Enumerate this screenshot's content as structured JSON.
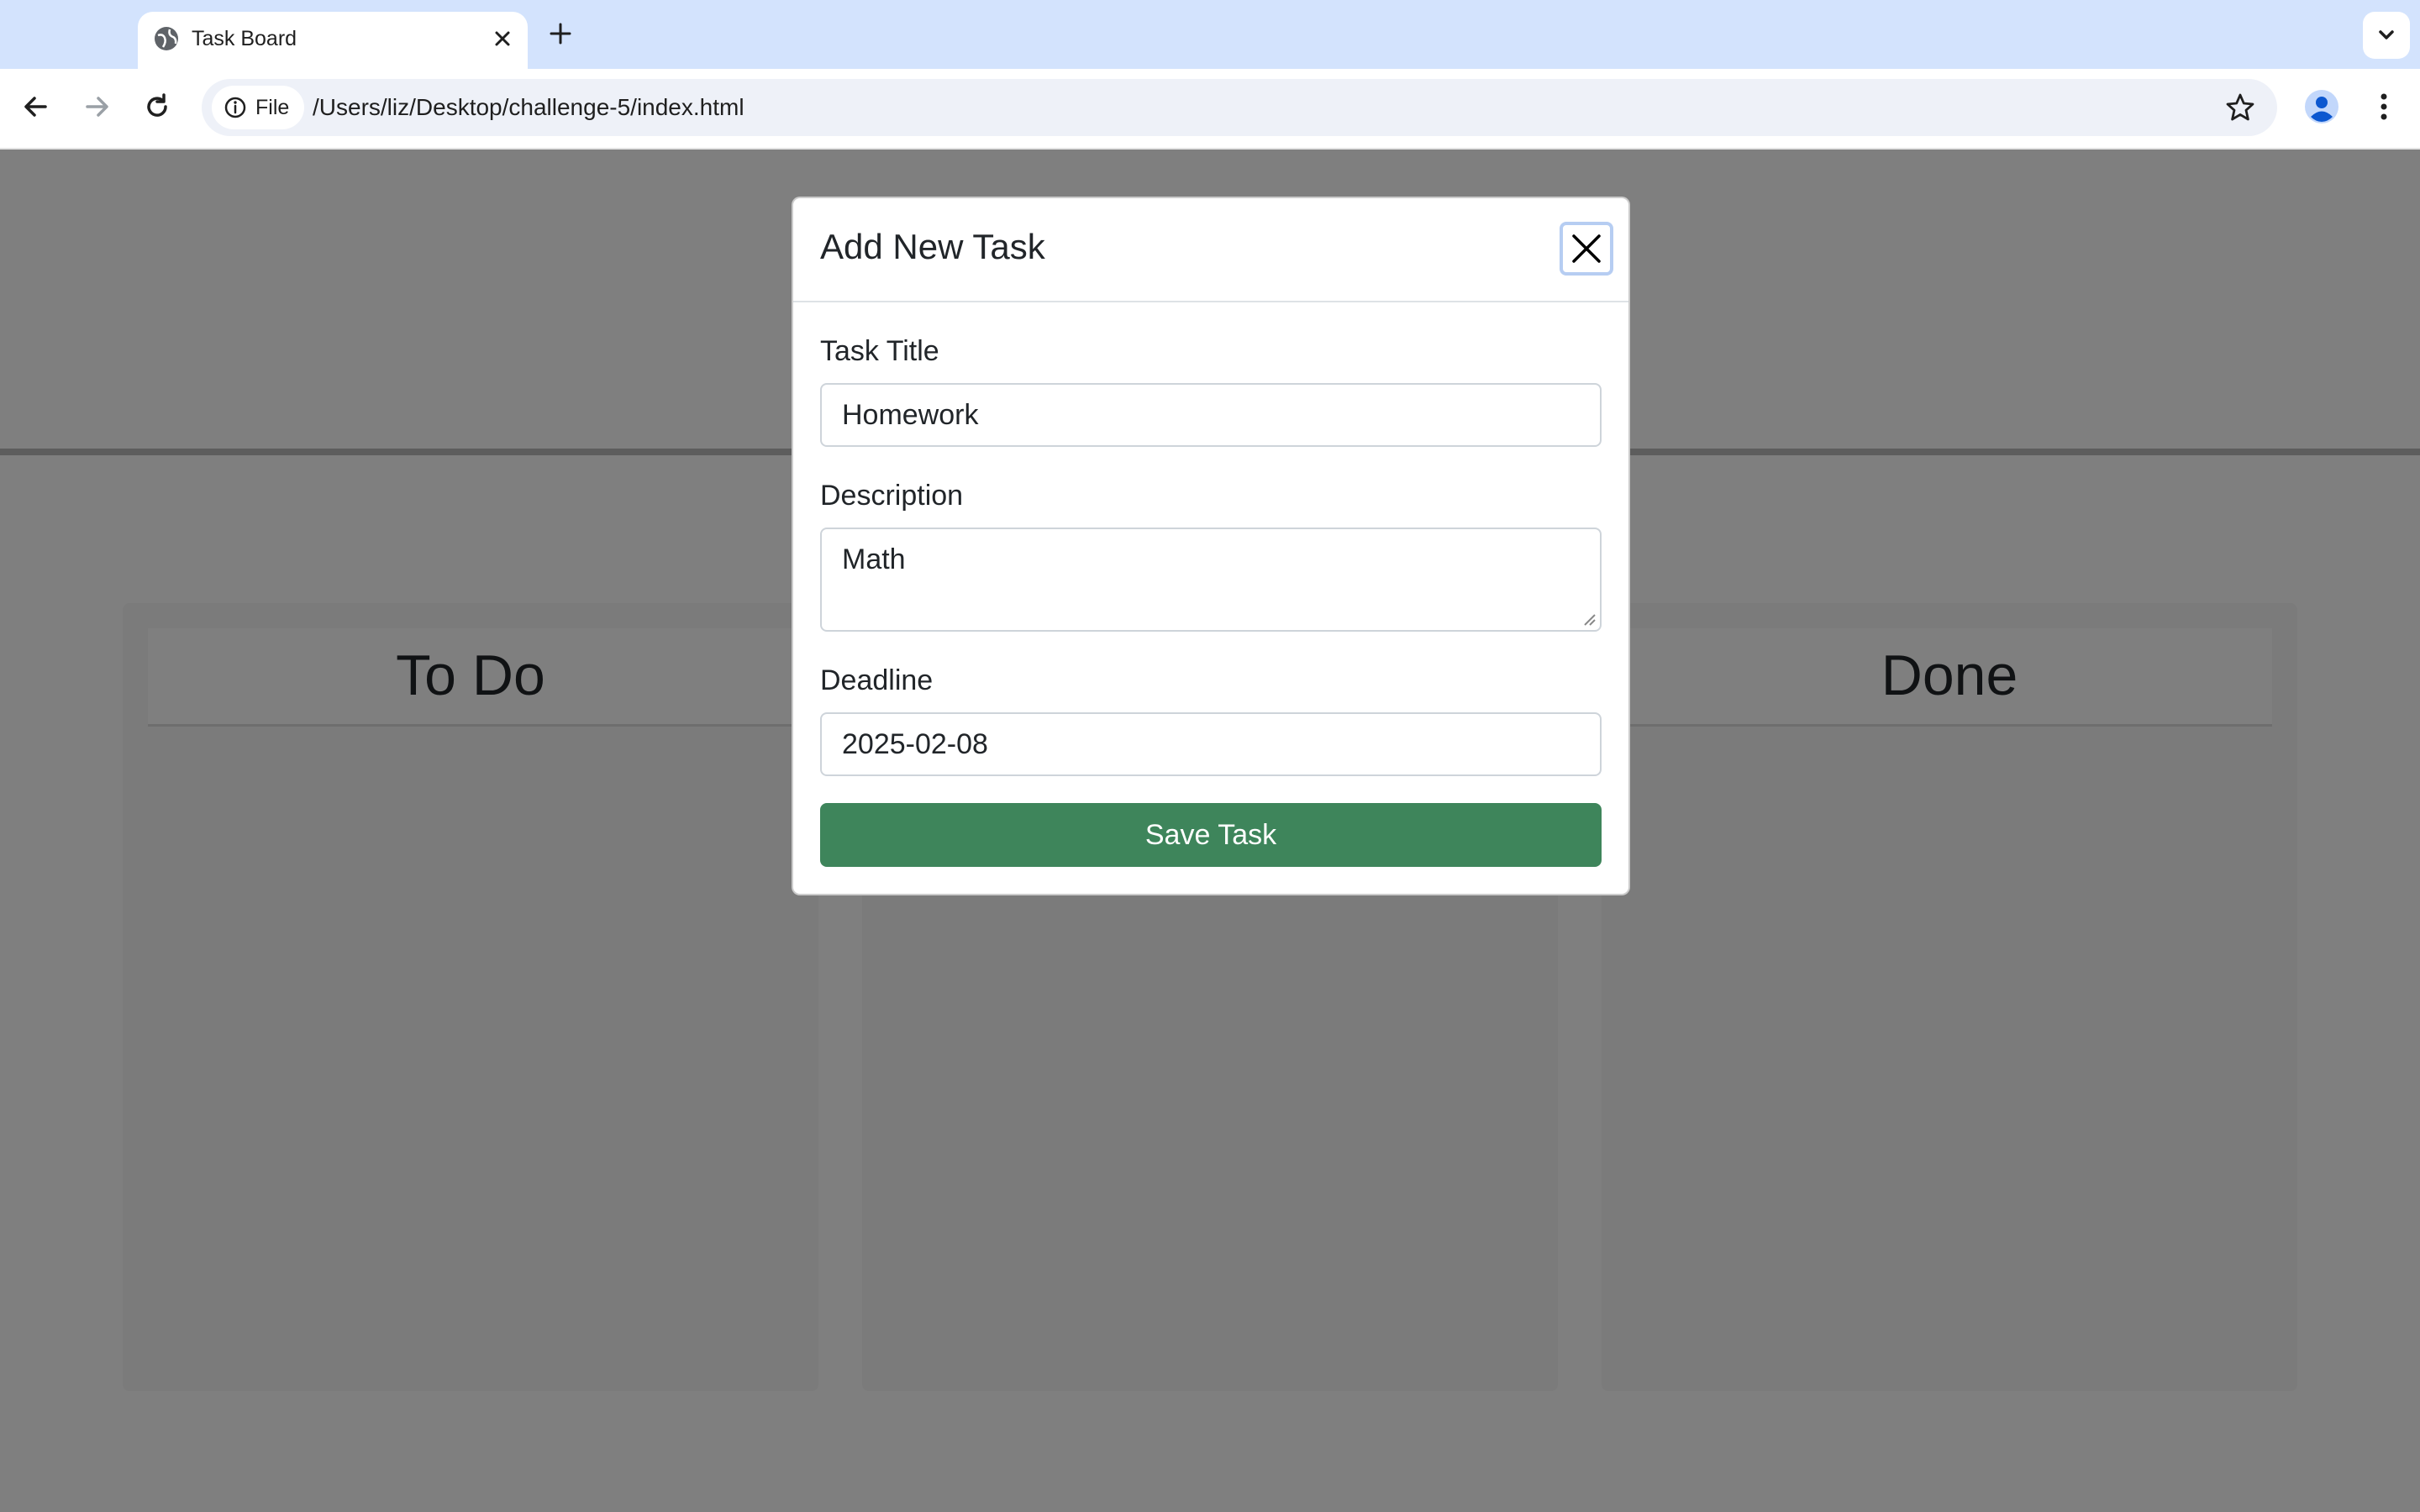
{
  "browser": {
    "tab": {
      "title": "Task Board"
    },
    "address": {
      "chip_label": "File",
      "url": "/Users/liz/Desktop/challenge-5/index.html"
    }
  },
  "board": {
    "lanes": [
      {
        "title": "To Do"
      },
      {
        "title": ""
      },
      {
        "title": "Done"
      }
    ]
  },
  "modal": {
    "title": "Add New Task",
    "fields": {
      "title_label": "Task Title",
      "title_value": "Homework",
      "description_label": "Description",
      "description_value": "Math",
      "deadline_label": "Deadline",
      "deadline_value": "2025-02-08"
    },
    "save_label": "Save Task"
  },
  "colors": {
    "tabstrip": "#d3e3fd",
    "save_button": "#3e855b",
    "overlay": "rgba(0,0,0,0.5)"
  },
  "icons": [
    "globe-icon",
    "close-icon",
    "plus-icon",
    "chevron-down-icon",
    "back-arrow-icon",
    "forward-arrow-icon",
    "reload-icon",
    "info-icon",
    "star-icon",
    "profile-icon",
    "kebab-menu-icon"
  ]
}
